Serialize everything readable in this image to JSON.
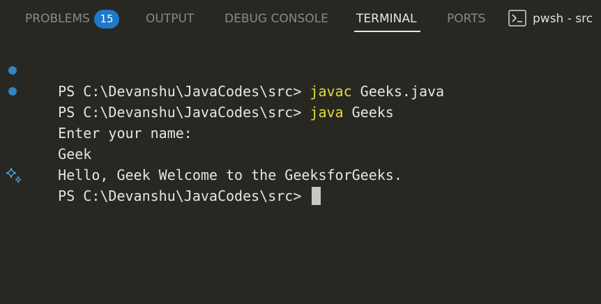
{
  "tabs": {
    "problems": "PROBLEMS",
    "problems_count": "15",
    "output": "OUTPUT",
    "debug_console": "DEBUG CONSOLE",
    "terminal": "TERMINAL",
    "ports": "PORTS"
  },
  "terminal_instance": {
    "icon": "terminal-icon",
    "name": "pwsh - src"
  },
  "lines": [
    {
      "prompt": "PS C:\\Devanshu\\JavaCodes\\src> ",
      "command": "javac",
      "args": " Geeks.java",
      "marker": "success-dot"
    },
    {
      "prompt": "PS C:\\Devanshu\\JavaCodes\\src> ",
      "command": "java",
      "args": " Geeks",
      "marker": "success-dot"
    },
    {
      "output": "Enter your name:"
    },
    {
      "output": "Geek"
    },
    {
      "output": "Hello, Geek Welcome to the GeeksforGeeks."
    },
    {
      "prompt": "PS C:\\Devanshu\\JavaCodes\\src> ",
      "marker": "sparkle-icon"
    }
  ],
  "colors": {
    "background": "#272822",
    "command": "#e6db3a",
    "badge": "#1f78c8",
    "dot": "#2f86c4",
    "text": "#e6e6e0"
  }
}
